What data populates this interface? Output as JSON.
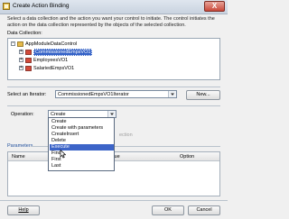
{
  "window": {
    "title": "Create Action Binding",
    "close_label": "X"
  },
  "description": "Select a data collection and the action you want your control to initiate. The control initiates the action on the data collection represented by the objects of the selected collection.",
  "data_collection": {
    "label": "Data Collection:",
    "tree": [
      {
        "label": "AppModuleDataControl",
        "level": 0,
        "expander": "-"
      },
      {
        "label": "CommissionedEmpsVO1",
        "level": 1,
        "expander": "+",
        "selected": true
      },
      {
        "label": "EmployeesVO1",
        "level": 1,
        "expander": "+"
      },
      {
        "label": "SalariedEmpsVO1",
        "level": 1,
        "expander": "+"
      }
    ]
  },
  "iterator": {
    "label": "Select an Iterator:",
    "value": "CommissionedEmpsVO1Iterator",
    "new_button": "New..."
  },
  "operation": {
    "label": "Operation:",
    "value": "Create",
    "options": [
      "Create",
      "Create with parameters",
      "CreateInsert",
      "Delete",
      "Execute",
      "Find",
      "First",
      "Last"
    ],
    "highlighted_index": 4,
    "behind_text": "ection"
  },
  "parameters": {
    "label": "Parameters",
    "columns": [
      "Name",
      "Value",
      "Option"
    ]
  },
  "footer": {
    "help": "Help",
    "ok": "OK",
    "cancel": "Cancel"
  },
  "colors": {
    "selection": "#3361c6",
    "titlebar": "#c9d3e0"
  }
}
